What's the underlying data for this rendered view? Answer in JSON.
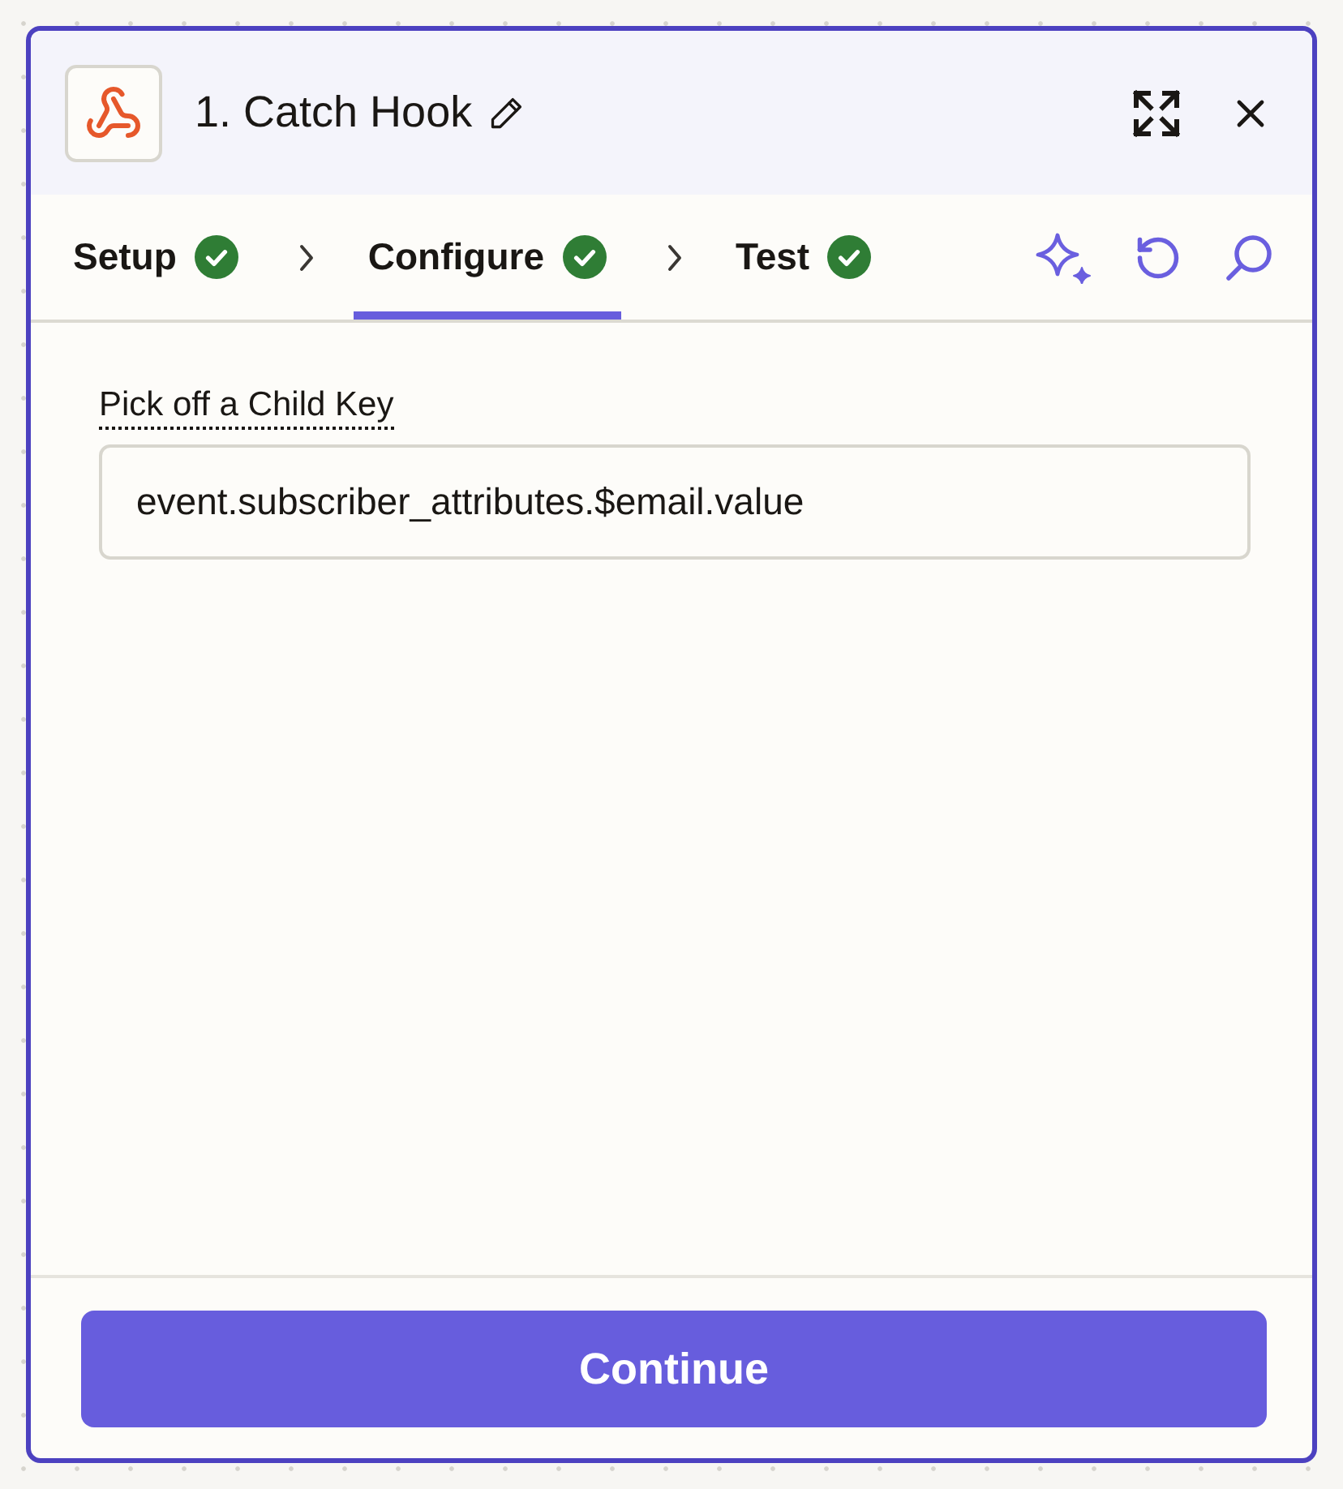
{
  "step_panel": {
    "title": "1. Catch Hook"
  },
  "tabs": [
    {
      "label": "Setup",
      "completed": true,
      "selected": false
    },
    {
      "label": "Configure",
      "completed": true,
      "selected": true
    },
    {
      "label": "Test",
      "completed": true,
      "selected": false
    }
  ],
  "field": {
    "label": "Pick off a Child Key",
    "value": "event.subscriber_attributes.$email.value"
  },
  "buttons": [
    {
      "label": "Continue"
    }
  ]
}
